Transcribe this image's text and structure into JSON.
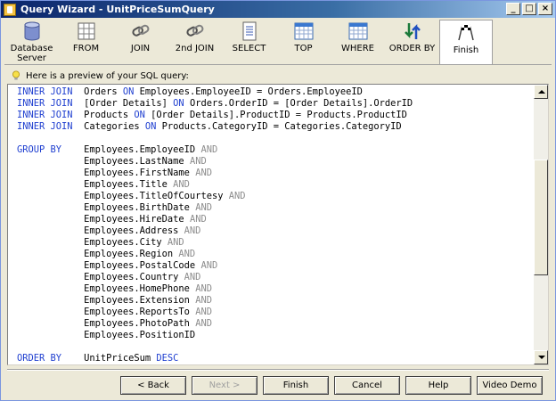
{
  "window": {
    "title": "Query Wizard - UnitPriceSumQuery"
  },
  "controls": {
    "minimize": "_",
    "maximize": "□",
    "close": "×"
  },
  "toolbar": {
    "items": [
      {
        "label": "Database\nServer",
        "icon": "database-icon"
      },
      {
        "label": "FROM",
        "icon": "table-grid-icon"
      },
      {
        "label": "JOIN",
        "icon": "chain-link-icon"
      },
      {
        "label": "2nd JOIN",
        "icon": "chain-link-icon"
      },
      {
        "label": "SELECT",
        "icon": "document-list-icon"
      },
      {
        "label": "TOP",
        "icon": "calendar-grid-icon"
      },
      {
        "label": "WHERE",
        "icon": "calendar-grid-icon"
      },
      {
        "label": "ORDER BY",
        "icon": "sort-arrows-icon"
      },
      {
        "label": "Finish",
        "icon": "checkered-flags-icon"
      }
    ],
    "active_index": 8
  },
  "hint": {
    "text": "Here is a preview of your SQL query:"
  },
  "sql": [
    [
      [
        "kw",
        "INNER JOIN"
      ],
      [
        "t",
        "  Orders "
      ],
      [
        "kw",
        "ON"
      ],
      [
        "t",
        " Employees.EmployeeID = Orders.EmployeeID"
      ]
    ],
    [
      [
        "kw",
        "INNER JOIN"
      ],
      [
        "t",
        "  [Order Details] "
      ],
      [
        "kw",
        "ON"
      ],
      [
        "t",
        " Orders.OrderID = [Order Details].OrderID"
      ]
    ],
    [
      [
        "kw",
        "INNER JOIN"
      ],
      [
        "t",
        "  Products "
      ],
      [
        "kw",
        "ON"
      ],
      [
        "t",
        " [Order Details].ProductID = Products.ProductID"
      ]
    ],
    [
      [
        "kw",
        "INNER JOIN"
      ],
      [
        "t",
        "  Categories "
      ],
      [
        "kw",
        "ON"
      ],
      [
        "t",
        " Products.CategoryID = Categories.CategoryID"
      ]
    ],
    [],
    [
      [
        "kw",
        "GROUP BY"
      ],
      [
        "t",
        "    Employees.EmployeeID "
      ],
      [
        "op",
        "AND"
      ]
    ],
    [
      [
        "t",
        "            Employees.LastName "
      ],
      [
        "op",
        "AND"
      ]
    ],
    [
      [
        "t",
        "            Employees.FirstName "
      ],
      [
        "op",
        "AND"
      ]
    ],
    [
      [
        "t",
        "            Employees.Title "
      ],
      [
        "op",
        "AND"
      ]
    ],
    [
      [
        "t",
        "            Employees.TitleOfCourtesy "
      ],
      [
        "op",
        "AND"
      ]
    ],
    [
      [
        "t",
        "            Employees.BirthDate "
      ],
      [
        "op",
        "AND"
      ]
    ],
    [
      [
        "t",
        "            Employees.HireDate "
      ],
      [
        "op",
        "AND"
      ]
    ],
    [
      [
        "t",
        "            Employees.Address "
      ],
      [
        "op",
        "AND"
      ]
    ],
    [
      [
        "t",
        "            Employees.City "
      ],
      [
        "op",
        "AND"
      ]
    ],
    [
      [
        "t",
        "            Employees.Region "
      ],
      [
        "op",
        "AND"
      ]
    ],
    [
      [
        "t",
        "            Employees.PostalCode "
      ],
      [
        "op",
        "AND"
      ]
    ],
    [
      [
        "t",
        "            Employees.Country "
      ],
      [
        "op",
        "AND"
      ]
    ],
    [
      [
        "t",
        "            Employees.HomePhone "
      ],
      [
        "op",
        "AND"
      ]
    ],
    [
      [
        "t",
        "            Employees.Extension "
      ],
      [
        "op",
        "AND"
      ]
    ],
    [
      [
        "t",
        "            Employees.ReportsTo "
      ],
      [
        "op",
        "AND"
      ]
    ],
    [
      [
        "t",
        "            Employees.PhotoPath "
      ],
      [
        "op",
        "AND"
      ]
    ],
    [
      [
        "t",
        "            Employees.PositionID"
      ]
    ],
    [],
    [
      [
        "kw",
        "ORDER BY"
      ],
      [
        "t",
        "    UnitPriceSum "
      ],
      [
        "kw",
        "DESC"
      ]
    ]
  ],
  "scrollbar": {
    "position": 0.45
  },
  "buttons": {
    "back": "< Back",
    "next": "Next >",
    "finish": "Finish",
    "cancel": "Cancel",
    "help": "Help",
    "video": "Video Demo"
  },
  "colors": {
    "keyword": "#1f3fd0",
    "operator": "#8c8c8c",
    "titlebar": "#0a246a"
  }
}
